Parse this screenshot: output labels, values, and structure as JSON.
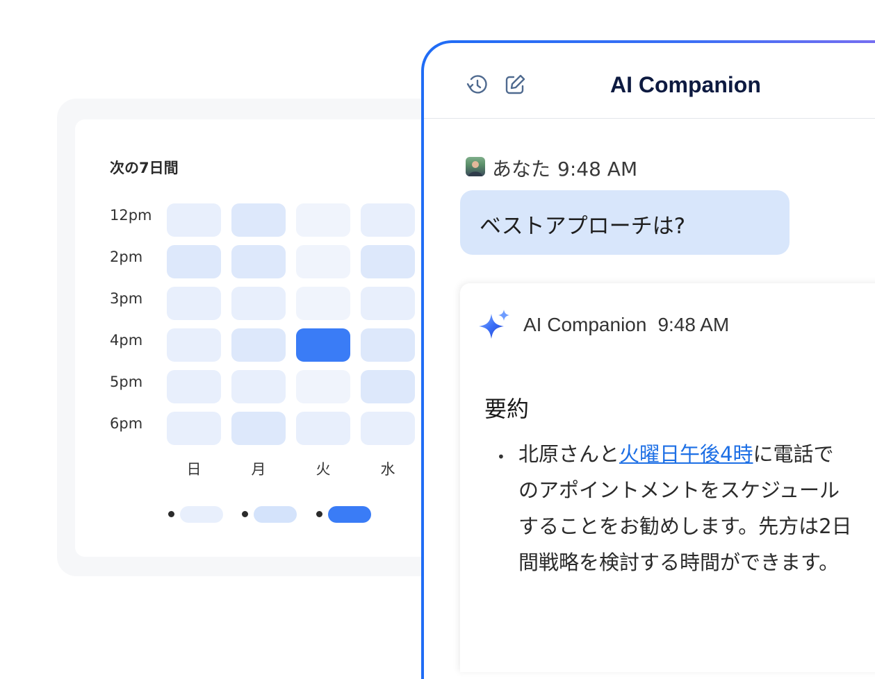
{
  "calendar": {
    "title": "次の7日間",
    "times": [
      "12pm",
      "2pm",
      "3pm",
      "4pm",
      "5pm",
      "6pm"
    ],
    "days": [
      "日",
      "月",
      "火",
      "水"
    ],
    "cell_levels": [
      [
        1,
        2,
        0,
        1
      ],
      [
        2,
        2,
        0,
        2
      ],
      [
        1,
        1,
        0,
        1
      ],
      [
        1,
        2,
        3,
        2
      ],
      [
        1,
        1,
        0,
        2
      ],
      [
        1,
        2,
        1,
        1
      ]
    ],
    "level_colors": [
      "#f0f4fc",
      "#e8effc",
      "#dde8fb",
      "#3a7cf6"
    ],
    "legend_colors": [
      "#e8effc",
      "#d4e3fb",
      "#3a7cf6"
    ]
  },
  "panel": {
    "title": "AI Companion",
    "icons": [
      "history-icon",
      "compose-icon"
    ],
    "accent": "#1f6cf5"
  },
  "user_message": {
    "sender": "あなた",
    "time": "9:48 AM",
    "text": "ベストアプローチは?"
  },
  "ai_message": {
    "sender": "AI Companion",
    "time": "9:48 AM",
    "icon": "sparkle-icon",
    "heading": "要約",
    "bullet": "•",
    "text_before": "北原さんと",
    "link_text": "火曜日午後4時",
    "text_after": "に電話でのアポイントメントをスケジュールすることをお勧めします。先方は2日間戦略を検討する時間ができます。",
    "link_color": "#1d6fe5"
  }
}
